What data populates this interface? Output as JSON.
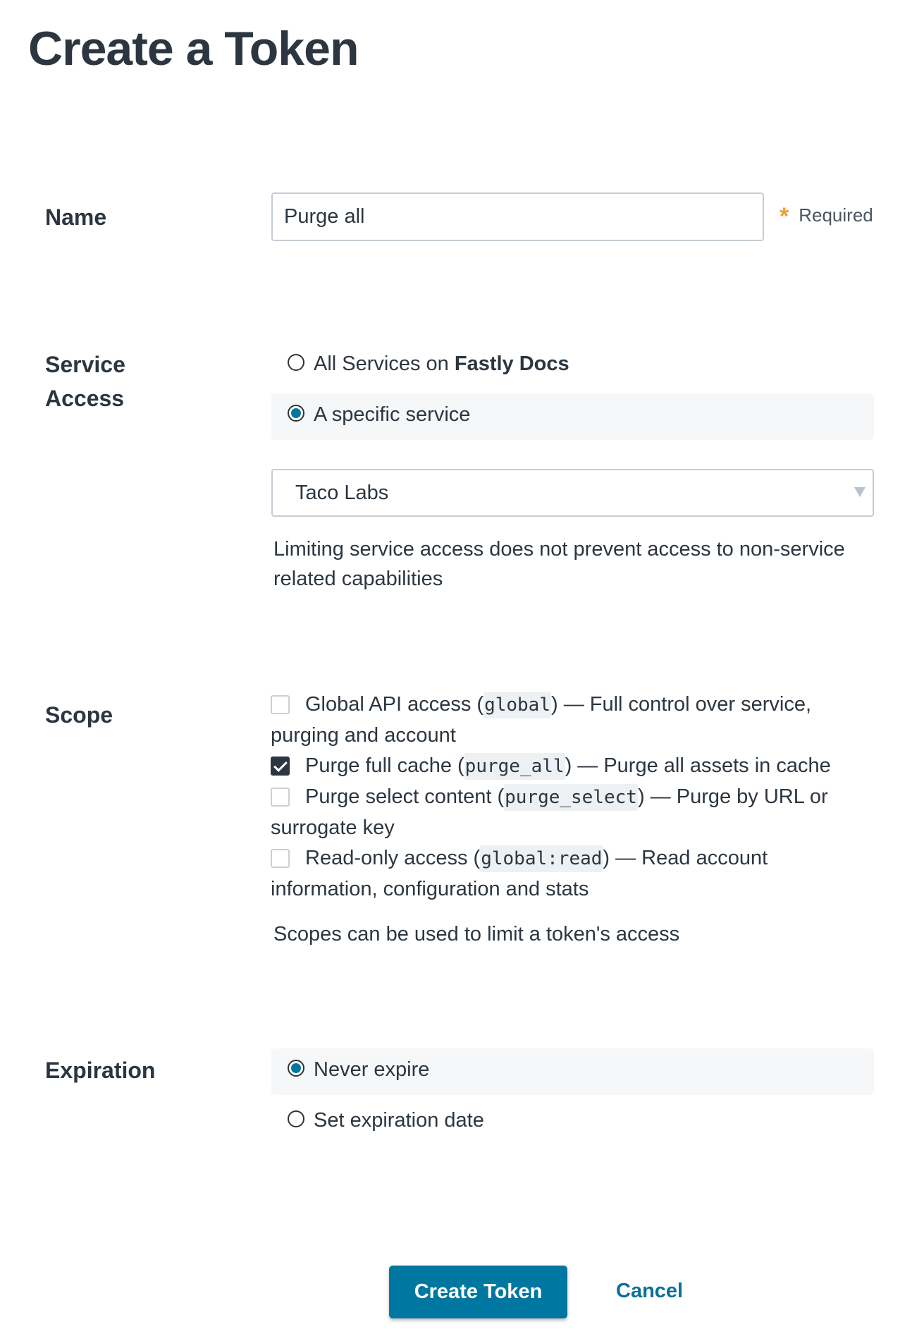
{
  "page": {
    "title": "Create a Token"
  },
  "name_field": {
    "label": "Name",
    "value": "Purge all",
    "required_label": "Required"
  },
  "service_access": {
    "label_line1": "Service",
    "label_line2": "Access",
    "options": [
      {
        "label_prefix": "All Services on ",
        "label_bold": "Fastly Docs",
        "selected": false
      },
      {
        "label_prefix": "A specific service",
        "label_bold": "",
        "selected": true
      }
    ],
    "service_select": {
      "value": "Taco Labs"
    },
    "help_line1": "Limiting service access does not prevent access to non-service",
    "help_line2": "related capabilities"
  },
  "scope": {
    "label": "Scope",
    "items": [
      {
        "pre": "Global API access (",
        "code": "global",
        "post": ") — Full control over service,",
        "wrap": "purging and account",
        "checked": false
      },
      {
        "pre": "Purge full cache (",
        "code": "purge_all",
        "post": ") — Purge all assets in cache",
        "wrap": "",
        "checked": true
      },
      {
        "pre": "Purge select content (",
        "code": "purge_select",
        "post": ") — Purge by URL or",
        "wrap": "surrogate key",
        "checked": false
      },
      {
        "pre": "Read-only access (",
        "code": "global:read",
        "post": ") — Read account",
        "wrap": "information, configuration and stats",
        "checked": false
      }
    ],
    "help": "Scopes can be used to limit a token's access"
  },
  "expiration": {
    "label": "Expiration",
    "options": [
      {
        "label": "Never expire",
        "selected": true
      },
      {
        "label": "Set expiration date",
        "selected": false
      }
    ]
  },
  "actions": {
    "create_label": "Create Token",
    "cancel_label": "Cancel"
  },
  "colors": {
    "primary": "#0077a0",
    "required_star": "#f39c34",
    "text": "#2c3640"
  }
}
